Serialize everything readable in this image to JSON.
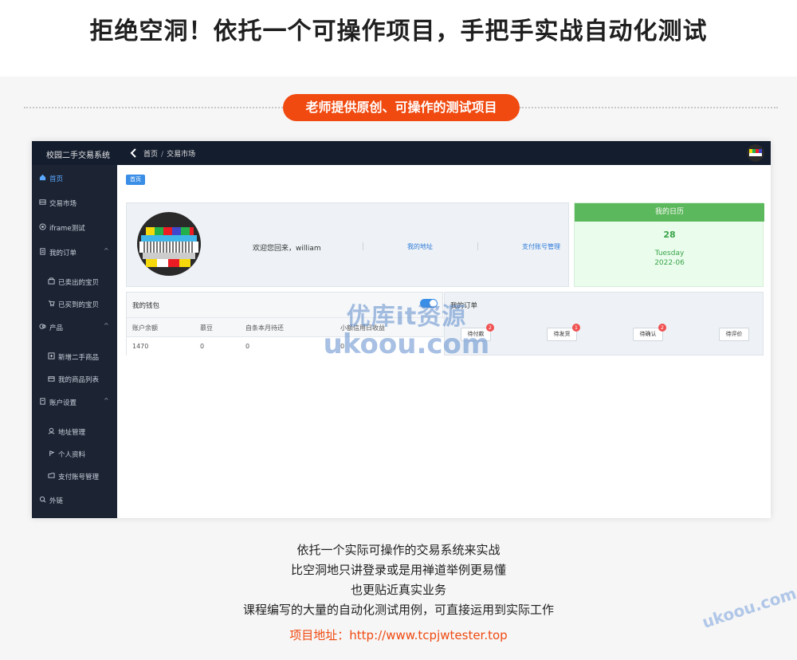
{
  "hero": {
    "title": "拒绝空洞！依托一个可操作项目，手把手实战自动化测试"
  },
  "pill": {
    "label": "老师提供原创、可操作的测试项目"
  },
  "app": {
    "brand": "校园二手交易系统",
    "breadcrumbs": [
      "首页",
      "交易市场"
    ],
    "breadcrumb_sep": "/",
    "sidebar": {
      "items": [
        {
          "label": "首页",
          "icon": "home-icon"
        },
        {
          "label": "交易市场",
          "icon": "market-icon"
        },
        {
          "label": "iframe测试",
          "icon": "frame-icon"
        },
        {
          "label": "我的订单",
          "icon": "orders-icon",
          "arrow": "^"
        },
        {
          "label": "已卖出的宝贝",
          "icon": "sold-icon"
        },
        {
          "label": "已买到的宝贝",
          "icon": "bought-icon"
        },
        {
          "label": "产品",
          "icon": "product-icon",
          "arrow": "^"
        },
        {
          "label": "新增二手商品",
          "icon": "add-goods-icon"
        },
        {
          "label": "我的商品列表",
          "icon": "goods-list-icon"
        },
        {
          "label": "账户设置",
          "icon": "account-icon",
          "arrow": "^"
        },
        {
          "label": "地址管理",
          "icon": "address-icon"
        },
        {
          "label": "个人资料",
          "icon": "profile-icon"
        },
        {
          "label": "支付账号管理",
          "icon": "pay-account-icon"
        },
        {
          "label": "外链",
          "icon": "external-link-icon"
        }
      ]
    },
    "home_tag": "首页",
    "welcome": {
      "text": "欢迎您回来，william",
      "address_link": "我的地址",
      "pay_link": "支付账号管理"
    },
    "calendar": {
      "title": "我的日历",
      "day": "28",
      "weekday": "Tuesday",
      "month": "2022-06"
    },
    "wallet": {
      "title": "我的钱包",
      "columns": [
        "账户余额",
        "慕豆",
        "自条本月待还",
        "小额信用日收益"
      ],
      "values": [
        "1470",
        "0",
        "0",
        "0"
      ]
    },
    "orders": {
      "title": "我的订单",
      "buttons": [
        {
          "label": "待付款",
          "badge": "2"
        },
        {
          "label": "待发货",
          "badge": "1"
        },
        {
          "label": "待确认",
          "badge": "2"
        },
        {
          "label": "待评价",
          "badge": ""
        }
      ]
    }
  },
  "watermark": {
    "cn": "优库it资源",
    "en": "ukoou.com"
  },
  "description": {
    "lines": [
      "依托一个实际可操作的交易系统来实战",
      "比空洞地只讲登录或是用禅道举例更易懂",
      "也更贴近真实业务",
      "课程编写的大量的自动化测试用例，可直接运用到实际工作"
    ],
    "url_label": "项目地址：http://www.tcpjwtester.top"
  },
  "corner_watermark": "ukoou.com",
  "colors": {
    "accent": "#f04a10",
    "topbar": "#141d2e",
    "sidebar": "#1c2434",
    "link": "#2f7bd9",
    "calendar_head": "#5cb85c",
    "badge": "#f05050"
  }
}
